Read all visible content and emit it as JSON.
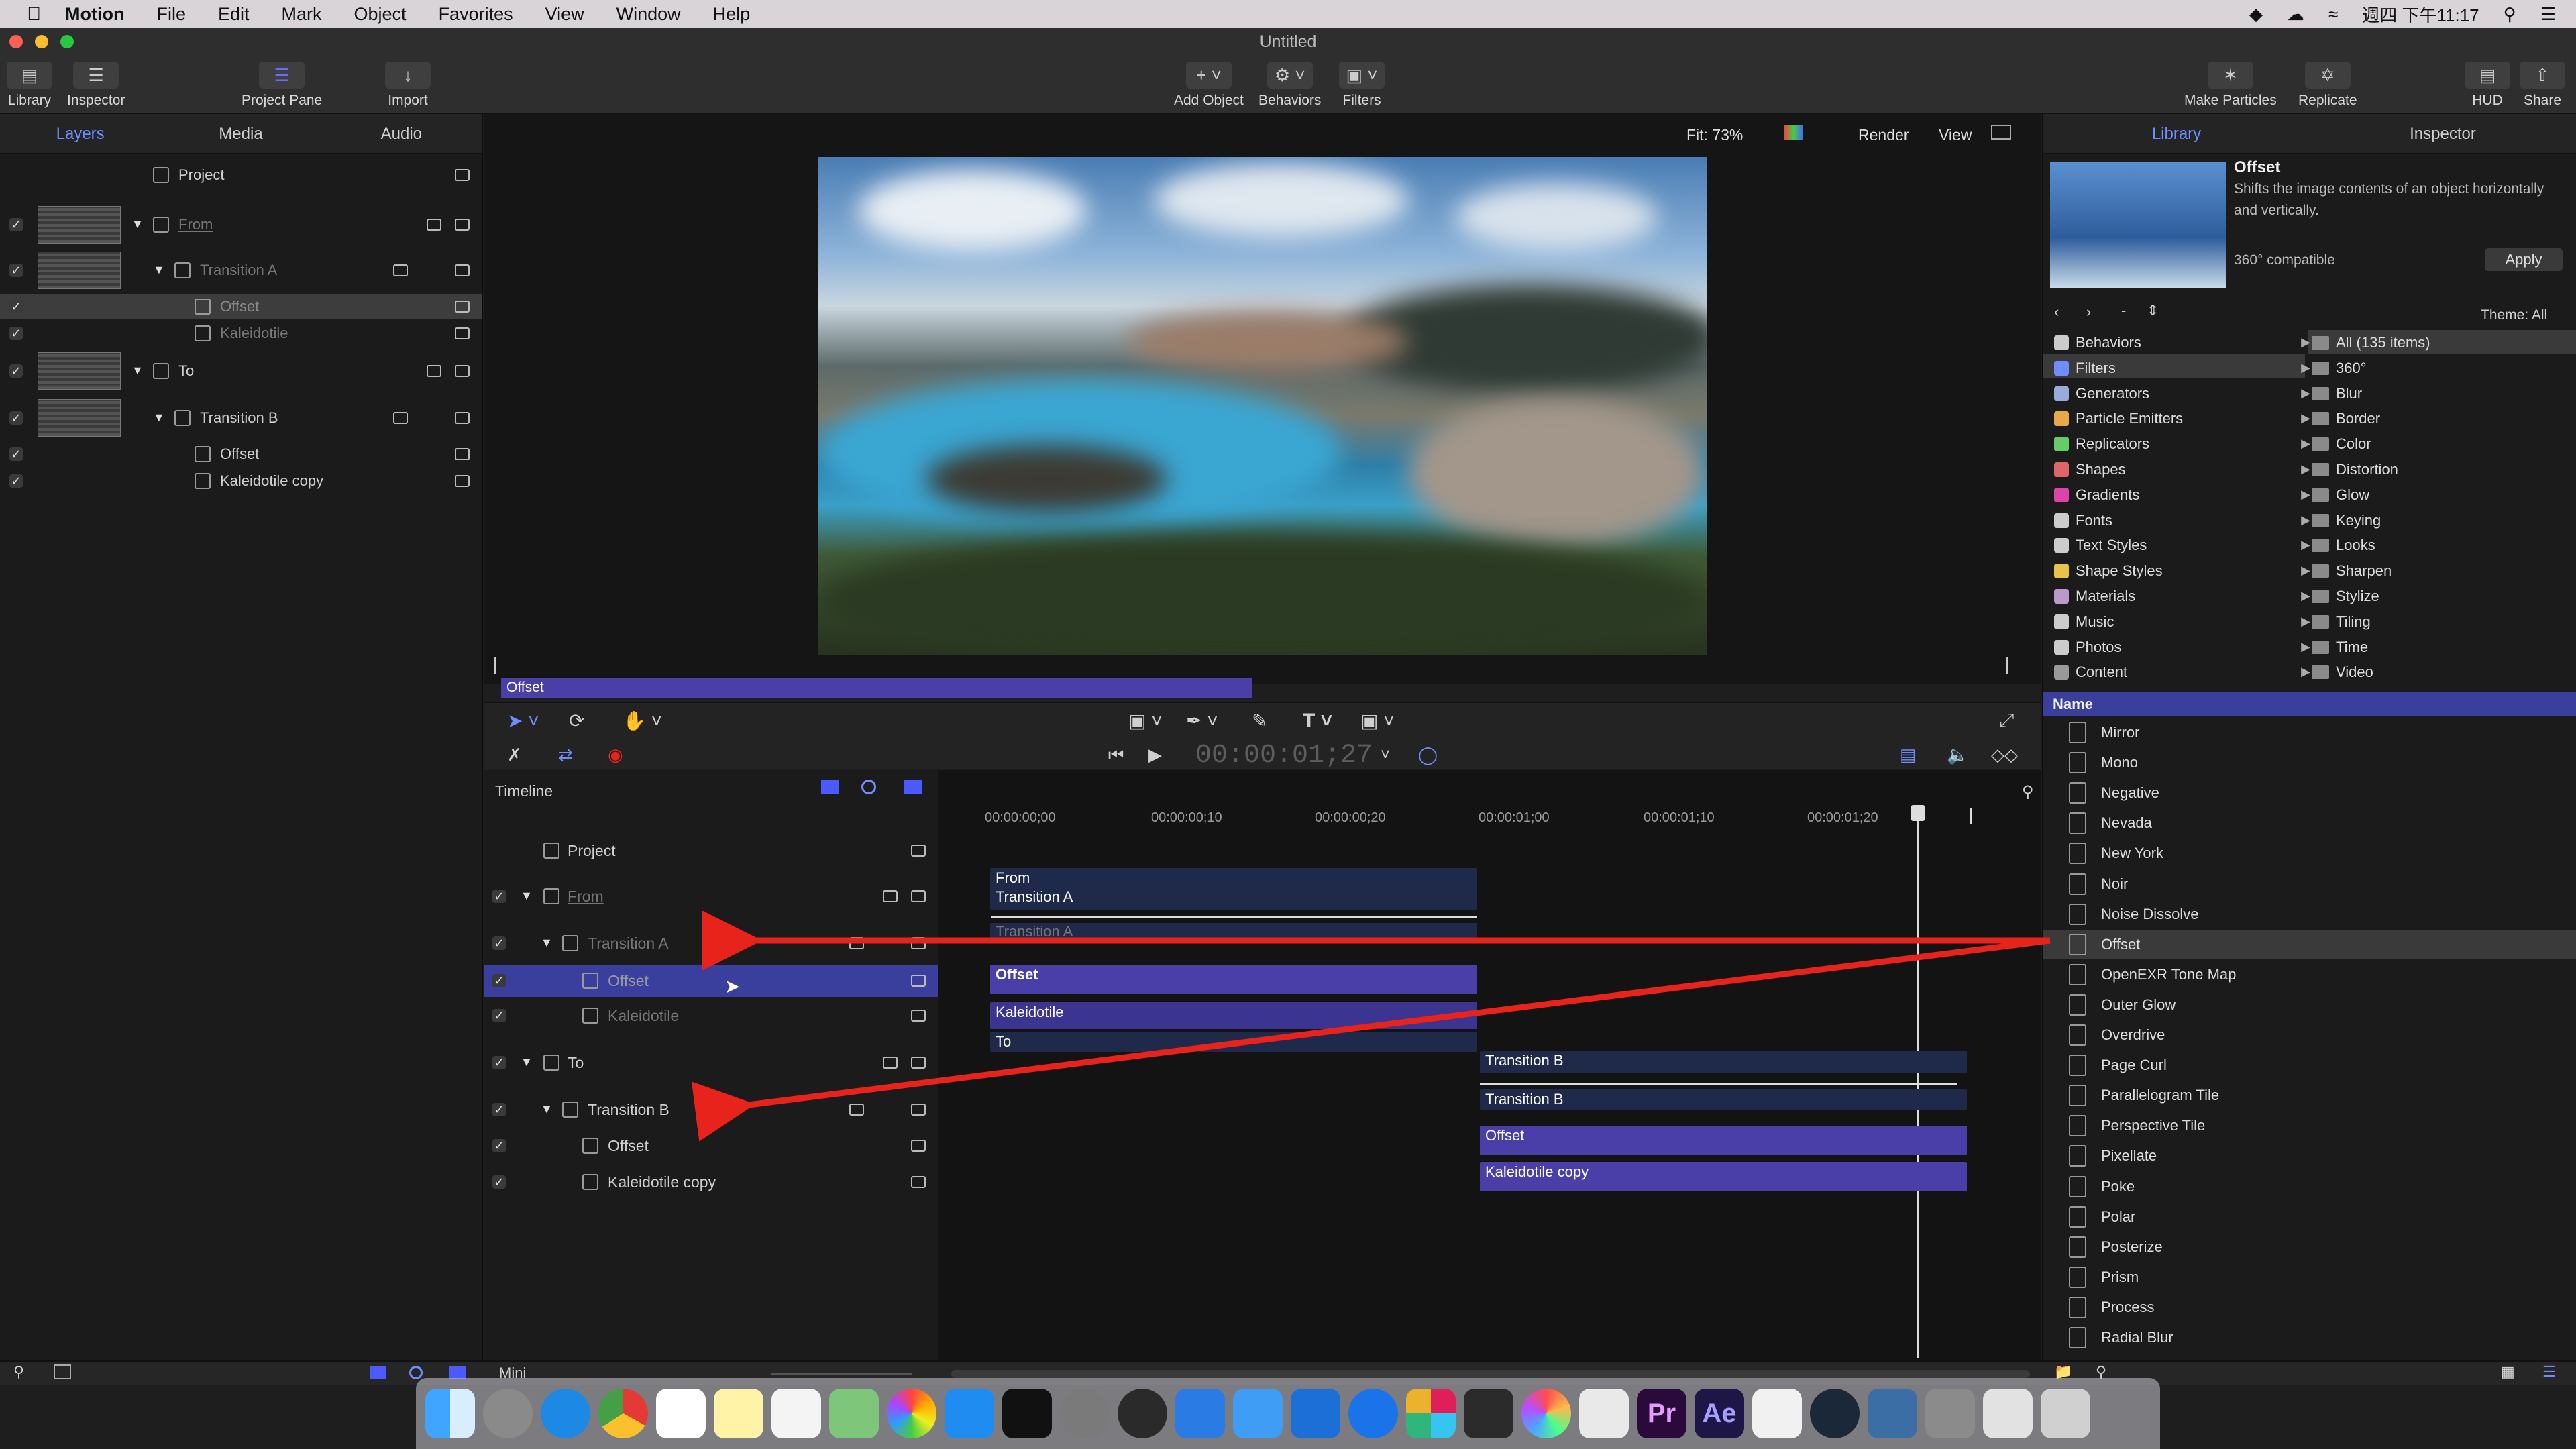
{
  "menubar": {
    "app": "Motion",
    "items": [
      "File",
      "Edit",
      "Mark",
      "Object",
      "Favorites",
      "View",
      "Window",
      "Help"
    ],
    "clock": "週四 下午11:17"
  },
  "window": {
    "title": "Untitled"
  },
  "toolbar": {
    "library": "Library",
    "inspector": "Inspector",
    "project_pane": "Project Pane",
    "import": "Import",
    "add_object": "Add Object",
    "behaviors": "Behaviors",
    "filters": "Filters",
    "make_particles": "Make Particles",
    "replicate": "Replicate",
    "hud": "HUD",
    "share": "Share"
  },
  "left_tabs": [
    "Layers",
    "Media",
    "Audio"
  ],
  "layers": [
    {
      "name": "Project"
    },
    {
      "name": "From"
    },
    {
      "name": "Transition A"
    },
    {
      "name": "Offset"
    },
    {
      "name": "Kaleidotile"
    },
    {
      "name": "To"
    },
    {
      "name": "Transition B"
    },
    {
      "name": "Offset"
    },
    {
      "name": "Kaleidotile copy"
    }
  ],
  "viewer": {
    "fit": "Fit: 73%",
    "render": "Render",
    "view": "View",
    "scrub_label": "Offset"
  },
  "timeline": {
    "label": "Timeline",
    "timecode": "00:00:01;27",
    "ticks": [
      "00:00:00;00",
      "00:00:00;10",
      "00:00:00;20",
      "00:00:01;00",
      "00:00:01;10",
      "00:00:01;20"
    ],
    "rows": [
      {
        "name": "Project"
      },
      {
        "name": "From"
      },
      {
        "name": "Transition A"
      },
      {
        "name": "Offset"
      },
      {
        "name": "Kaleidotile"
      },
      {
        "name": "To"
      },
      {
        "name": "Transition B"
      },
      {
        "name": "Offset"
      },
      {
        "name": "Kaleidotile copy"
      }
    ],
    "bars": {
      "from": "From",
      "trans_a": "Transition A",
      "trans_a2": "Transition A",
      "offset": "Offset",
      "kaleido": "Kaleidotile",
      "to": "To",
      "trans_b": "Transition B",
      "trans_b2": "Transition B",
      "offset_b": "Offset",
      "kaleido_copy": "Kaleidotile copy"
    },
    "mini": "Mini"
  },
  "library": {
    "tabs": [
      "Library",
      "Inspector"
    ],
    "preview": {
      "title": "Offset",
      "desc": "Shifts the image contents of an object horizontally and vertically.",
      "compat": "360° compatible",
      "apply": "Apply"
    },
    "theme": "Theme: All",
    "categories": [
      "Behaviors",
      "Filters",
      "Generators",
      "Particle Emitters",
      "Replicators",
      "Shapes",
      "Gradients",
      "Fonts",
      "Text Styles",
      "Shape Styles",
      "Materials",
      "Music",
      "Photos",
      "Content"
    ],
    "subcategories": [
      "All (135 items)",
      "360°",
      "Blur",
      "Border",
      "Color",
      "Distortion",
      "Glow",
      "Keying",
      "Looks",
      "Sharpen",
      "Stylize",
      "Tiling",
      "Time",
      "Video"
    ],
    "list_header": "Name",
    "items": [
      "Mirror",
      "Mono",
      "Negative",
      "Nevada",
      "New York",
      "Noir",
      "Noise Dissolve",
      "Offset",
      "OpenEXR Tone Map",
      "Outer Glow",
      "Overdrive",
      "Page Curl",
      "Parallelogram Tile",
      "Perspective Tile",
      "Pixellate",
      "Poke",
      "Polar",
      "Posterize",
      "Prism",
      "Process",
      "Radial Blur"
    ]
  },
  "colors": {
    "accent": "#4a3fa8",
    "selected_row": "#3a3f9e",
    "arrow": "#e8231b"
  }
}
